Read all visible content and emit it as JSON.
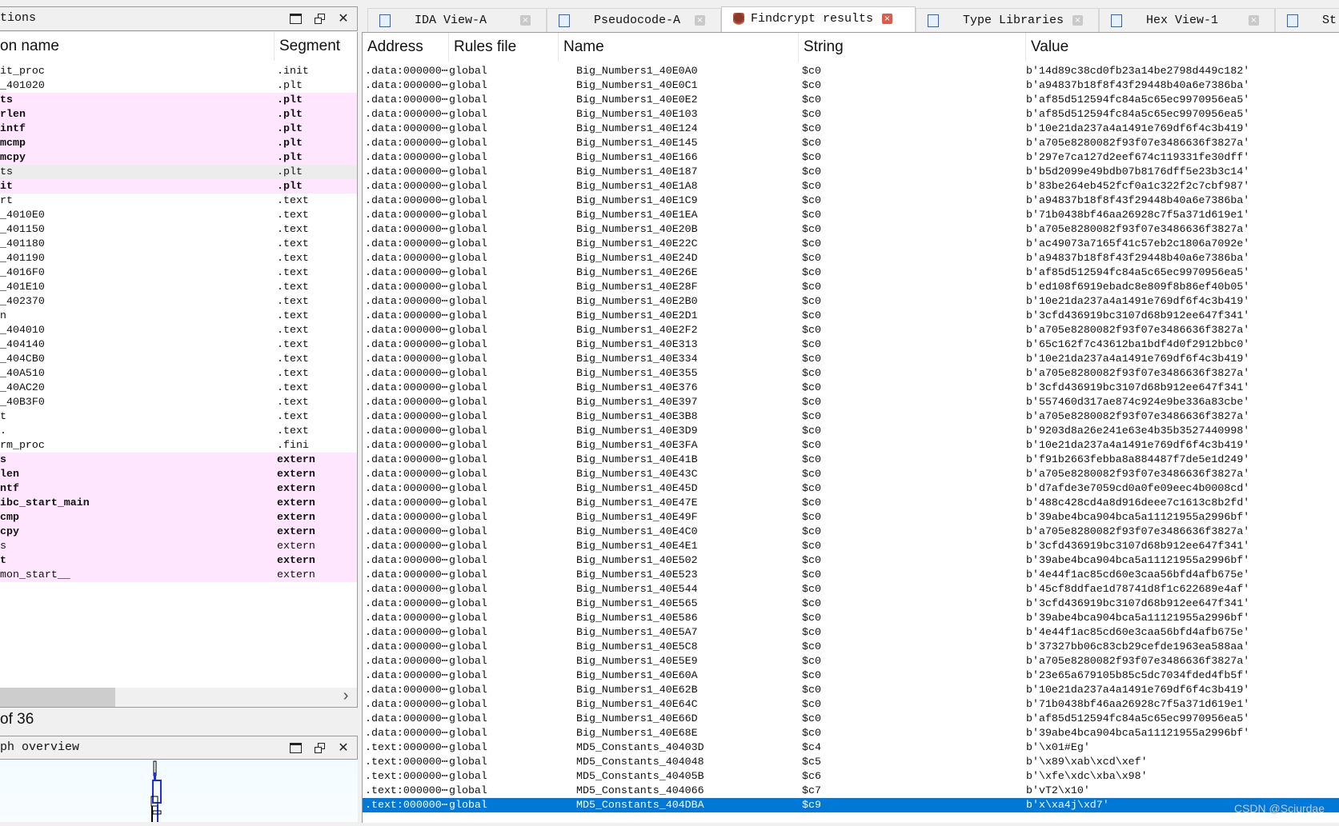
{
  "left_panel": {
    "title": "tions",
    "columns": [
      "on name",
      "Segment"
    ],
    "rows": [
      {
        "name": "it_proc",
        "segment": ".init",
        "style": "normal"
      },
      {
        "name": "_401020",
        "segment": ".plt",
        "style": "normal"
      },
      {
        "name": "ts",
        "segment": ".plt",
        "style": "pink-bold"
      },
      {
        "name": "rlen",
        "segment": ".plt",
        "style": "pink-bold"
      },
      {
        "name": "intf",
        "segment": ".plt",
        "style": "pink-bold"
      },
      {
        "name": "mcmp",
        "segment": ".plt",
        "style": "pink-bold"
      },
      {
        "name": "mcpy",
        "segment": ".plt",
        "style": "pink-bold"
      },
      {
        "name": "ts",
        "segment": ".plt",
        "style": "grey"
      },
      {
        "name": "it",
        "segment": ".plt",
        "style": "pink-bold"
      },
      {
        "name": "rt",
        "segment": ".text",
        "style": "normal"
      },
      {
        "name": "_4010E0",
        "segment": ".text",
        "style": "normal"
      },
      {
        "name": "_401150",
        "segment": ".text",
        "style": "normal"
      },
      {
        "name": "_401180",
        "segment": ".text",
        "style": "normal"
      },
      {
        "name": "_401190",
        "segment": ".text",
        "style": "normal"
      },
      {
        "name": "_4016F0",
        "segment": ".text",
        "style": "normal"
      },
      {
        "name": "_401E10",
        "segment": ".text",
        "style": "normal"
      },
      {
        "name": "_402370",
        "segment": ".text",
        "style": "normal"
      },
      {
        "name": "n",
        "segment": ".text",
        "style": "normal"
      },
      {
        "name": "_404010",
        "segment": ".text",
        "style": "normal"
      },
      {
        "name": "_404140",
        "segment": ".text",
        "style": "normal"
      },
      {
        "name": "_404CB0",
        "segment": ".text",
        "style": "normal"
      },
      {
        "name": "_40A510",
        "segment": ".text",
        "style": "normal"
      },
      {
        "name": "_40AC20",
        "segment": ".text",
        "style": "normal"
      },
      {
        "name": "_40B3F0",
        "segment": ".text",
        "style": "normal"
      },
      {
        "name": "t",
        "segment": ".text",
        "style": "normal"
      },
      {
        "name": ".",
        "segment": ".text",
        "style": "normal"
      },
      {
        "name": "rm_proc",
        "segment": ".fini",
        "style": "normal"
      },
      {
        "name": "s",
        "segment": "extern",
        "style": "pink-bold"
      },
      {
        "name": "len",
        "segment": "extern",
        "style": "pink-bold"
      },
      {
        "name": "ntf",
        "segment": "extern",
        "style": "pink-bold"
      },
      {
        "name": "ibc_start_main",
        "segment": "extern",
        "style": "pink-bold"
      },
      {
        "name": "cmp",
        "segment": "extern",
        "style": "pink-bold"
      },
      {
        "name": "cpy",
        "segment": "extern",
        "style": "pink-bold"
      },
      {
        "name": "s",
        "segment": "extern",
        "style": "pink"
      },
      {
        "name": "t",
        "segment": "extern",
        "style": "pink-bold"
      },
      {
        "name": "mon_start__",
        "segment": "extern",
        "style": "pink"
      }
    ],
    "count_text": "of 36",
    "icons": [
      "maximize-icon",
      "float-icon",
      "close-icon"
    ]
  },
  "graph_panel": {
    "title": "ph overview"
  },
  "tabs": [
    {
      "label": "IDA View-A",
      "icon": "ida-view-icon",
      "active": false
    },
    {
      "label": "Pseudocode-A",
      "icon": "pseudocode-icon",
      "active": false
    },
    {
      "label": "Findcrypt results",
      "icon": "findcrypt-icon",
      "active": true
    },
    {
      "label": "Type Libraries",
      "icon": "type-libraries-icon",
      "active": false
    },
    {
      "label": "Hex View-1",
      "icon": "hex-view-icon",
      "active": false
    },
    {
      "label": "St",
      "icon": "strings-icon",
      "active": false
    }
  ],
  "results": {
    "columns": [
      "Address",
      "Rules file",
      "Name",
      "String",
      "Value"
    ],
    "selected_index": 51,
    "selection_color": "#0078d7",
    "rows": [
      [
        ".data:000000⋯",
        "global",
        "Big_Numbers1_40E0A0",
        "$c0",
        "b'14d89c38cd0fb23a14be2798d449c182'"
      ],
      [
        ".data:000000⋯",
        "global",
        "Big_Numbers1_40E0C1",
        "$c0",
        "b'a94837b18f8f43f29448b40a6e7386ba'"
      ],
      [
        ".data:000000⋯",
        "global",
        "Big_Numbers1_40E0E2",
        "$c0",
        "b'af85d512594fc84a5c65ec9970956ea5'"
      ],
      [
        ".data:000000⋯",
        "global",
        "Big_Numbers1_40E103",
        "$c0",
        "b'af85d512594fc84a5c65ec9970956ea5'"
      ],
      [
        ".data:000000⋯",
        "global",
        "Big_Numbers1_40E124",
        "$c0",
        "b'10e21da237a4a1491e769df6f4c3b419'"
      ],
      [
        ".data:000000⋯",
        "global",
        "Big_Numbers1_40E145",
        "$c0",
        "b'a705e8280082f93f07e3486636f3827a'"
      ],
      [
        ".data:000000⋯",
        "global",
        "Big_Numbers1_40E166",
        "$c0",
        "b'297e7ca127d2eef674c119331fe30dff'"
      ],
      [
        ".data:000000⋯",
        "global",
        "Big_Numbers1_40E187",
        "$c0",
        "b'b5d2099e49bdb07b8176dff5e23b3c14'"
      ],
      [
        ".data:000000⋯",
        "global",
        "Big_Numbers1_40E1A8",
        "$c0",
        "b'83be264eb452fcf0a1c322f2c7cbf987'"
      ],
      [
        ".data:000000⋯",
        "global",
        "Big_Numbers1_40E1C9",
        "$c0",
        "b'a94837b18f8f43f29448b40a6e7386ba'"
      ],
      [
        ".data:000000⋯",
        "global",
        "Big_Numbers1_40E1EA",
        "$c0",
        "b'71b0438bf46aa26928c7f5a371d619e1'"
      ],
      [
        ".data:000000⋯",
        "global",
        "Big_Numbers1_40E20B",
        "$c0",
        "b'a705e8280082f93f07e3486636f3827a'"
      ],
      [
        ".data:000000⋯",
        "global",
        "Big_Numbers1_40E22C",
        "$c0",
        "b'ac49073a7165f41c57eb2c1806a7092e'"
      ],
      [
        ".data:000000⋯",
        "global",
        "Big_Numbers1_40E24D",
        "$c0",
        "b'a94837b18f8f43f29448b40a6e7386ba'"
      ],
      [
        ".data:000000⋯",
        "global",
        "Big_Numbers1_40E26E",
        "$c0",
        "b'af85d512594fc84a5c65ec9970956ea5'"
      ],
      [
        ".data:000000⋯",
        "global",
        "Big_Numbers1_40E28F",
        "$c0",
        "b'ed108f6919ebadc8e809f8b86ef40b05'"
      ],
      [
        ".data:000000⋯",
        "global",
        "Big_Numbers1_40E2B0",
        "$c0",
        "b'10e21da237a4a1491e769df6f4c3b419'"
      ],
      [
        ".data:000000⋯",
        "global",
        "Big_Numbers1_40E2D1",
        "$c0",
        "b'3cfd436919bc3107d68b912ee647f341'"
      ],
      [
        ".data:000000⋯",
        "global",
        "Big_Numbers1_40E2F2",
        "$c0",
        "b'a705e8280082f93f07e3486636f3827a'"
      ],
      [
        ".data:000000⋯",
        "global",
        "Big_Numbers1_40E313",
        "$c0",
        "b'65c162f7c43612ba1bdf4d0f2912bbc0'"
      ],
      [
        ".data:000000⋯",
        "global",
        "Big_Numbers1_40E334",
        "$c0",
        "b'10e21da237a4a1491e769df6f4c3b419'"
      ],
      [
        ".data:000000⋯",
        "global",
        "Big_Numbers1_40E355",
        "$c0",
        "b'a705e8280082f93f07e3486636f3827a'"
      ],
      [
        ".data:000000⋯",
        "global",
        "Big_Numbers1_40E376",
        "$c0",
        "b'3cfd436919bc3107d68b912ee647f341'"
      ],
      [
        ".data:000000⋯",
        "global",
        "Big_Numbers1_40E397",
        "$c0",
        "b'557460d317ae874c924e9be336a83cbe'"
      ],
      [
        ".data:000000⋯",
        "global",
        "Big_Numbers1_40E3B8",
        "$c0",
        "b'a705e8280082f93f07e3486636f3827a'"
      ],
      [
        ".data:000000⋯",
        "global",
        "Big_Numbers1_40E3D9",
        "$c0",
        "b'9203d8a26e241e63e4b35b3527440998'"
      ],
      [
        ".data:000000⋯",
        "global",
        "Big_Numbers1_40E3FA",
        "$c0",
        "b'10e21da237a4a1491e769df6f4c3b419'"
      ],
      [
        ".data:000000⋯",
        "global",
        "Big_Numbers1_40E41B",
        "$c0",
        "b'f91b2663febba8a884487f7de5e1d249'"
      ],
      [
        ".data:000000⋯",
        "global",
        "Big_Numbers1_40E43C",
        "$c0",
        "b'a705e8280082f93f07e3486636f3827a'"
      ],
      [
        ".data:000000⋯",
        "global",
        "Big_Numbers1_40E45D",
        "$c0",
        "b'd7afde3e7059cd0a0fe09eec4b0008cd'"
      ],
      [
        ".data:000000⋯",
        "global",
        "Big_Numbers1_40E47E",
        "$c0",
        "b'488c428cd4a8d916deee7c1613c8b2fd'"
      ],
      [
        ".data:000000⋯",
        "global",
        "Big_Numbers1_40E49F",
        "$c0",
        "b'39abe4bca904bca5a11121955a2996bf'"
      ],
      [
        ".data:000000⋯",
        "global",
        "Big_Numbers1_40E4C0",
        "$c0",
        "b'a705e8280082f93f07e3486636f3827a'"
      ],
      [
        ".data:000000⋯",
        "global",
        "Big_Numbers1_40E4E1",
        "$c0",
        "b'3cfd436919bc3107d68b912ee647f341'"
      ],
      [
        ".data:000000⋯",
        "global",
        "Big_Numbers1_40E502",
        "$c0",
        "b'39abe4bca904bca5a11121955a2996bf'"
      ],
      [
        ".data:000000⋯",
        "global",
        "Big_Numbers1_40E523",
        "$c0",
        "b'4e44f1ac85cd60e3caa56bfd4afb675e'"
      ],
      [
        ".data:000000⋯",
        "global",
        "Big_Numbers1_40E544",
        "$c0",
        "b'45cf8ddfae1d78741d8f1c622689e4af'"
      ],
      [
        ".data:000000⋯",
        "global",
        "Big_Numbers1_40E565",
        "$c0",
        "b'3cfd436919bc3107d68b912ee647f341'"
      ],
      [
        ".data:000000⋯",
        "global",
        "Big_Numbers1_40E586",
        "$c0",
        "b'39abe4bca904bca5a11121955a2996bf'"
      ],
      [
        ".data:000000⋯",
        "global",
        "Big_Numbers1_40E5A7",
        "$c0",
        "b'4e44f1ac85cd60e3caa56bfd4afb675e'"
      ],
      [
        ".data:000000⋯",
        "global",
        "Big_Numbers1_40E5C8",
        "$c0",
        "b'37327bb06c83cb29cefde1963ea588aa'"
      ],
      [
        ".data:000000⋯",
        "global",
        "Big_Numbers1_40E5E9",
        "$c0",
        "b'a705e8280082f93f07e3486636f3827a'"
      ],
      [
        ".data:000000⋯",
        "global",
        "Big_Numbers1_40E60A",
        "$c0",
        "b'23e65a679105b85c5dc7034fded4fb5f'"
      ],
      [
        ".data:000000⋯",
        "global",
        "Big_Numbers1_40E62B",
        "$c0",
        "b'10e21da237a4a1491e769df6f4c3b419'"
      ],
      [
        ".data:000000⋯",
        "global",
        "Big_Numbers1_40E64C",
        "$c0",
        "b'71b0438bf46aa26928c7f5a371d619e1'"
      ],
      [
        ".data:000000⋯",
        "global",
        "Big_Numbers1_40E66D",
        "$c0",
        "b'af85d512594fc84a5c65ec9970956ea5'"
      ],
      [
        ".data:000000⋯",
        "global",
        "Big_Numbers1_40E68E",
        "$c0",
        "b'39abe4bca904bca5a11121955a2996bf'"
      ],
      [
        ".text:000000⋯",
        "global",
        "MD5_Constants_40403D",
        "$c4",
        "b'\\x01#Eg'"
      ],
      [
        ".text:000000⋯",
        "global",
        "MD5_Constants_404048",
        "$c5",
        "b'\\x89\\xab\\xcd\\xef'"
      ],
      [
        ".text:000000⋯",
        "global",
        "MD5_Constants_40405B",
        "$c6",
        "b'\\xfe\\xdc\\xba\\x98'"
      ],
      [
        ".text:000000⋯",
        "global",
        "MD5_Constants_404066",
        "$c7",
        "b'vT2\\x10'"
      ],
      [
        ".text:000000⋯",
        "global",
        "MD5_Constants_404DBA",
        "$c9",
        "b'x\\xa4j\\xd7'"
      ]
    ]
  },
  "watermark": "CSDN @Sciurdae"
}
